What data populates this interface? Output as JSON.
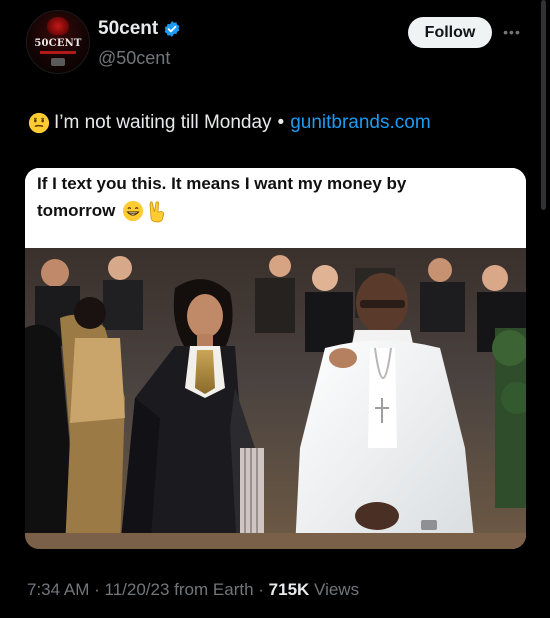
{
  "author": {
    "display_name": "50cent",
    "handle": "@50cent",
    "avatar_text": "50CENT",
    "verified_icon": "verified-badge-icon"
  },
  "actions": {
    "follow_label": "Follow",
    "more_icon": "more-horizontal-icon",
    "more_glyph": "•••"
  },
  "tweet": {
    "emoji": "grimacing-face-emoji",
    "text": "I’m not waiting till Monday",
    "separator": "•",
    "link_text": "gunitbrands.com"
  },
  "media": {
    "caption_line1": "If I text you this. It means I want my money by",
    "caption_line2": "tomorrow",
    "caption_emojis": [
      "grinning-face-emoji",
      "victory-hand-emoji"
    ]
  },
  "meta": {
    "time": "7:34 AM",
    "date": "11/20/23",
    "source": "from Earth",
    "views_count": "715K",
    "views_label": "Views",
    "sep": "·"
  },
  "colors": {
    "background": "#000000",
    "text": "#e7e9ea",
    "muted": "#71767b",
    "link": "#1d9bf0",
    "follow_bg": "#eff3f4"
  }
}
